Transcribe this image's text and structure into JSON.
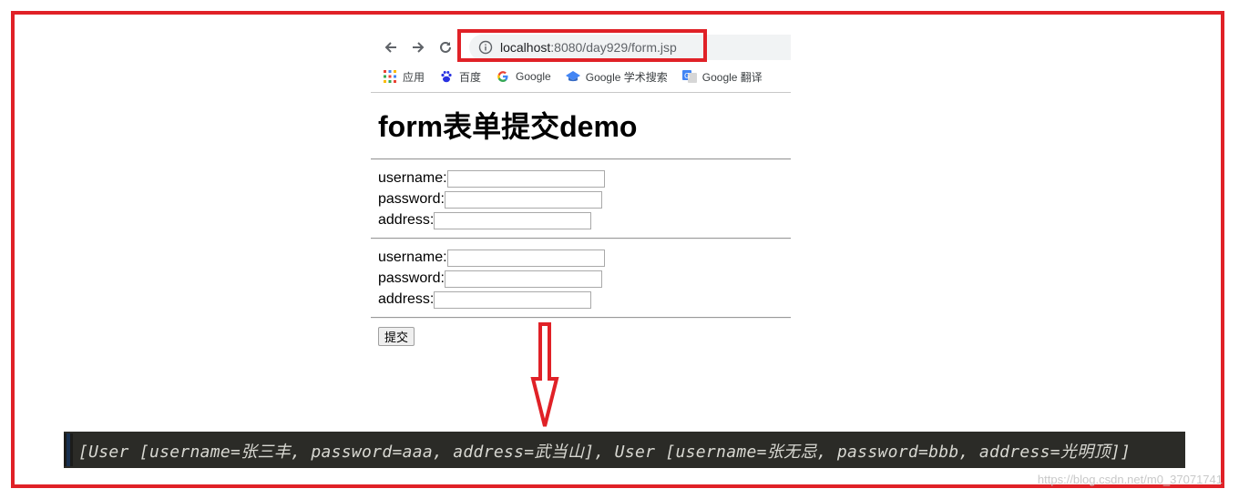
{
  "browser": {
    "url_host": "localhost",
    "url_path": ":8080/day929/form.jsp",
    "bookmarks": [
      {
        "label": "应用",
        "icon": "apps-grid-icon"
      },
      {
        "label": "百度",
        "icon": "baidu-paw-icon"
      },
      {
        "label": "Google",
        "icon": "google-g-icon"
      },
      {
        "label": "Google 学术搜索",
        "icon": "scholar-cap-icon"
      },
      {
        "label": "Google 翻译",
        "icon": "translate-icon"
      }
    ]
  },
  "page": {
    "title": "form表单提交demo",
    "groups": [
      {
        "username_label": "username:",
        "password_label": "password:",
        "address_label": "address:",
        "username_value": "",
        "password_value": "",
        "address_value": ""
      },
      {
        "username_label": "username:",
        "password_label": "password:",
        "address_label": "address:",
        "username_value": "",
        "password_value": "",
        "address_value": ""
      }
    ],
    "submit_label": "提交"
  },
  "console": {
    "output": "[User [username=张三丰, password=aaa, address=武当山], User [username=张无忌, password=bbb, address=光明顶]]"
  },
  "watermark": "https://blog.csdn.net/m0_37071741",
  "colors": {
    "annotation": "#e02127",
    "console_bg": "#2b2b27",
    "console_text": "#d8d8d2"
  }
}
